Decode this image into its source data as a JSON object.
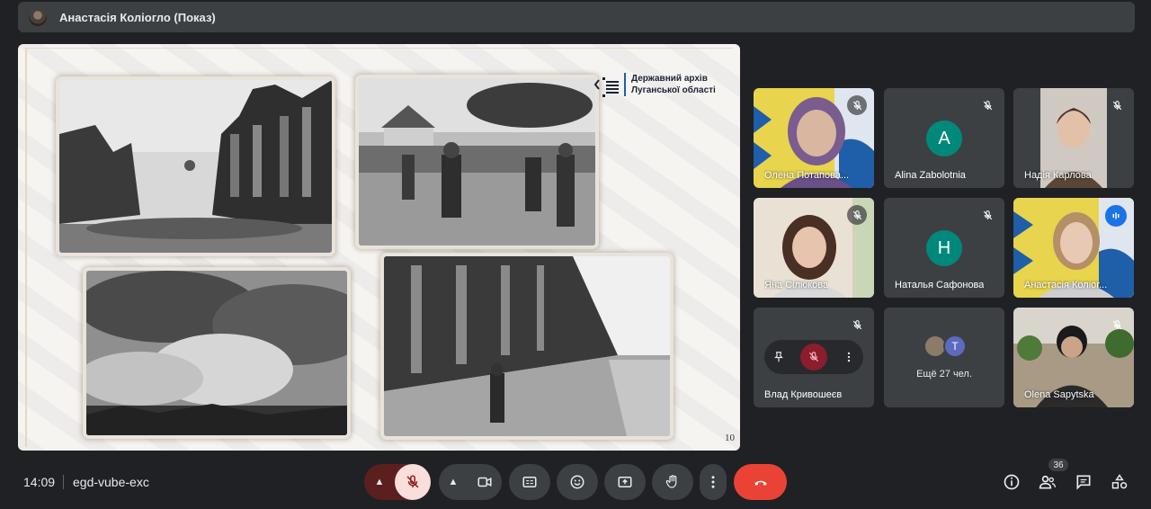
{
  "header": {
    "presenter_title": "Анастасія Коліогло (Показ)"
  },
  "slide": {
    "logo_line1": "Державний архів",
    "logo_line2": "Луганської області",
    "page_number": "10"
  },
  "participants": [
    {
      "name": "Олена Потапова...",
      "muted": true,
      "type": "video"
    },
    {
      "name": "Alina Zabolotnia",
      "muted": true,
      "type": "initial",
      "initial": "A",
      "color": "#00897b"
    },
    {
      "name": "Надія Карлова",
      "muted": true,
      "type": "video"
    },
    {
      "name": "Яна Сілюкова",
      "muted": true,
      "type": "video"
    },
    {
      "name": "Наталья Сафонова",
      "muted": true,
      "type": "initial",
      "initial": "H",
      "color": "#00897b"
    },
    {
      "name": "Анастасія Коліог...",
      "muted": false,
      "speaking": true,
      "type": "video"
    },
    {
      "name": "Влад Кривошеєв",
      "muted": true,
      "type": "pinned"
    },
    {
      "name": "",
      "type": "more",
      "more_label": "Ещё 27 чел.",
      "more_initial": "T"
    },
    {
      "name": "Olena Sapytska",
      "muted": true,
      "type": "video"
    }
  ],
  "bottom": {
    "time": "14:09",
    "meeting_code": "egd-vube-exc",
    "participant_count": "36"
  },
  "colors": {
    "background": "#202124",
    "tile": "#3c4043",
    "end_call": "#ea4335",
    "mic_off": "#f9dedc",
    "accent": "#8ab4f8"
  }
}
